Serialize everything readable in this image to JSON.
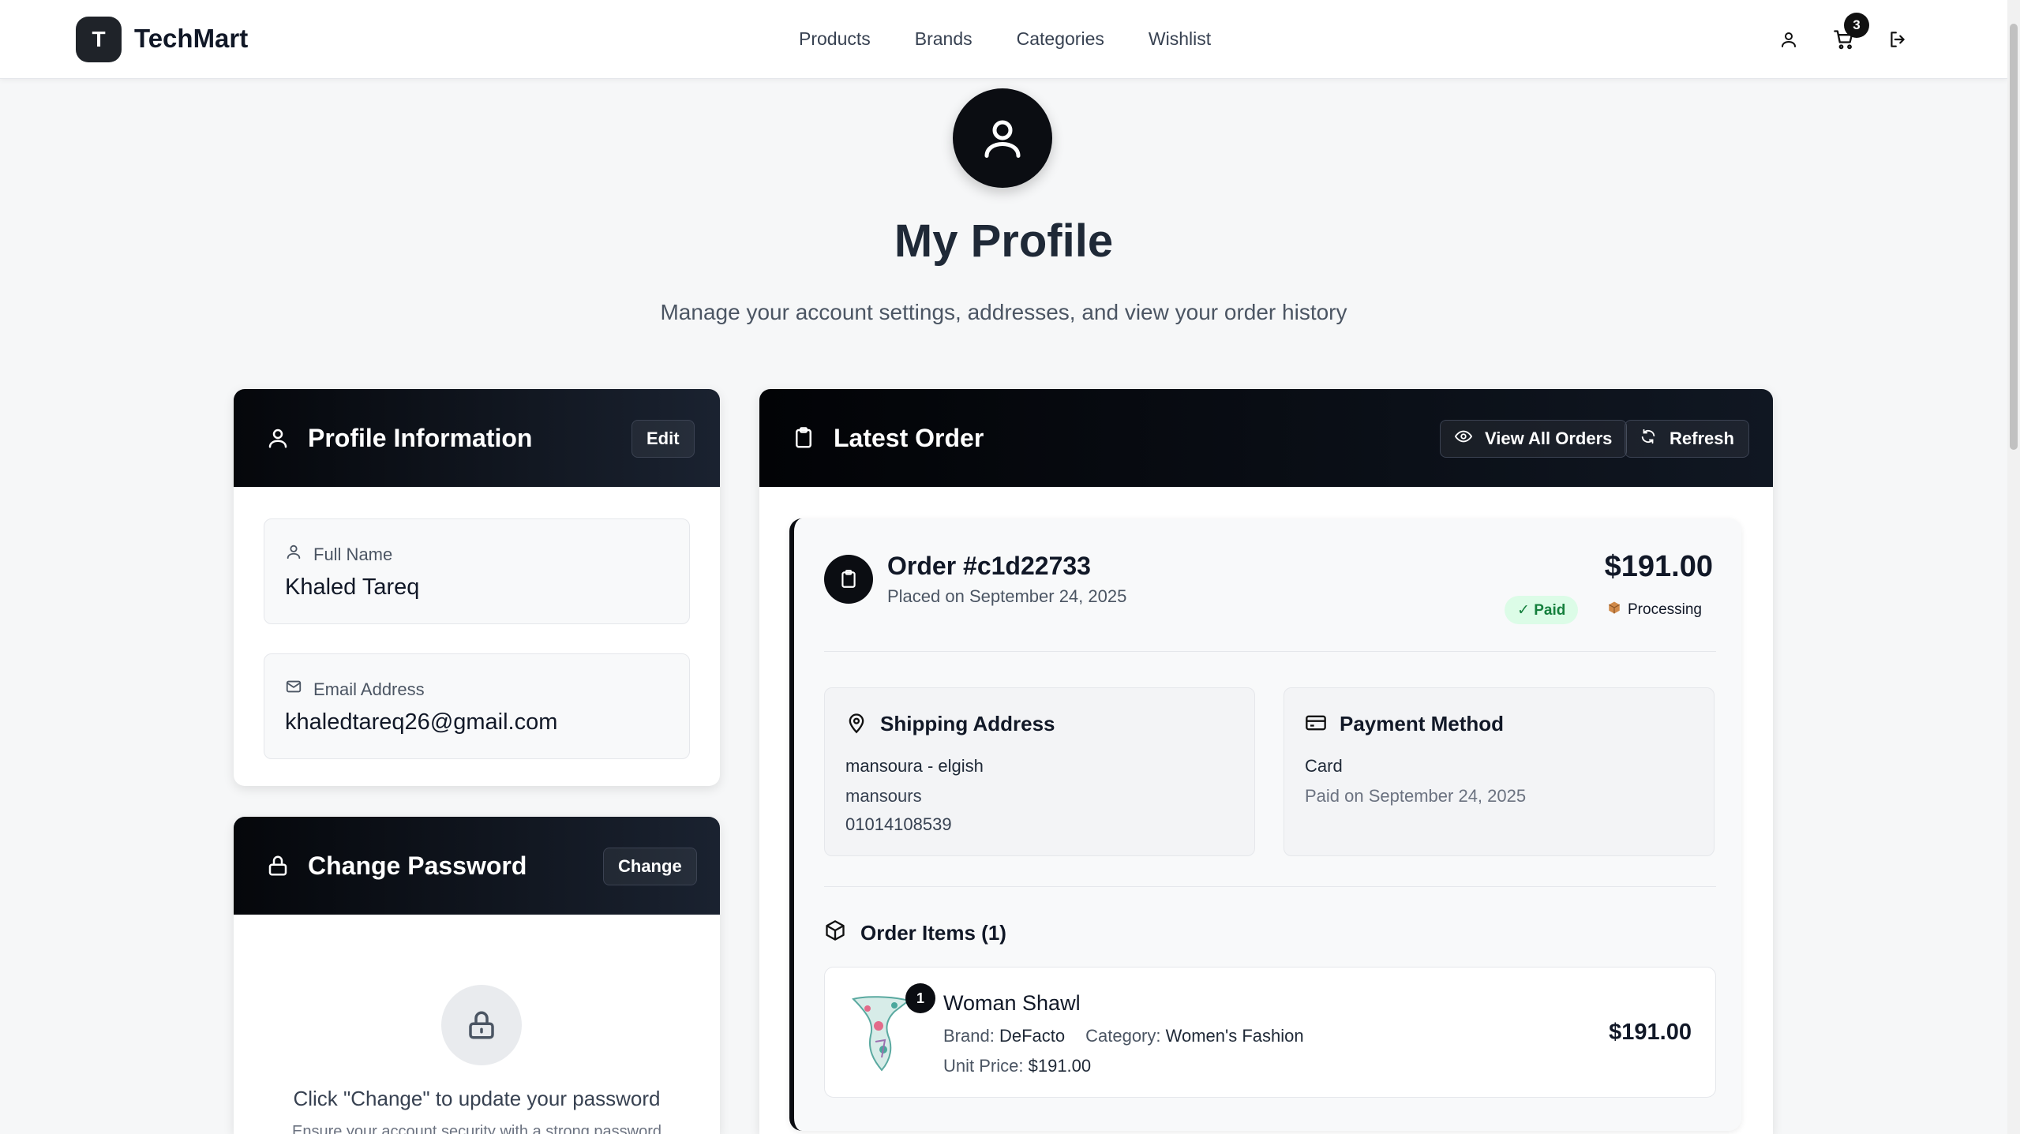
{
  "nav": {
    "brand_letter": "T",
    "brand": "TechMart",
    "links": [
      "Products",
      "Brands",
      "Categories",
      "Wishlist"
    ],
    "cart_count": "3"
  },
  "hero": {
    "title": "My Profile",
    "subtitle": "Manage your account settings, addresses, and view your order history"
  },
  "profile": {
    "title": "Profile Information",
    "edit_label": "Edit",
    "full_name_label": "Full Name",
    "full_name": "Khaled Tareq",
    "email_label": "Email Address",
    "email": "khaledtareq26@gmail.com"
  },
  "password": {
    "title": "Change Password",
    "change_label": "Change",
    "hint": "Click \"Change\" to update your password",
    "sub": "Ensure your account security with a strong password"
  },
  "order": {
    "card_title": "Latest Order",
    "view_all_label": "View All Orders",
    "refresh_label": "Refresh",
    "number": "Order #c1d22733",
    "placed": "Placed on September 24, 2025",
    "total": "$191.00",
    "paid_badge": "✓ Paid",
    "status_badge": "Processing",
    "shipping": {
      "title": "Shipping Address",
      "line1": "mansoura - elgish",
      "line2": "mansours",
      "phone": "01014108539"
    },
    "payment": {
      "title": "Payment Method",
      "method": "Card",
      "paid_on": "Paid on September 24, 2025"
    },
    "items_title": "Order Items (1)",
    "items": [
      {
        "qty": "1",
        "name": "Woman Shawl",
        "brand_label": "Brand:",
        "brand": "DeFacto",
        "category_label": "Category:",
        "category": "Women's Fashion",
        "unit_label": "Unit Price:",
        "unit_price": "$191.00",
        "price": "$191.00"
      }
    ]
  },
  "colors": {
    "header_dark": "#05070b",
    "paid_bg": "#dcfce7",
    "paid_text": "#15803d"
  }
}
